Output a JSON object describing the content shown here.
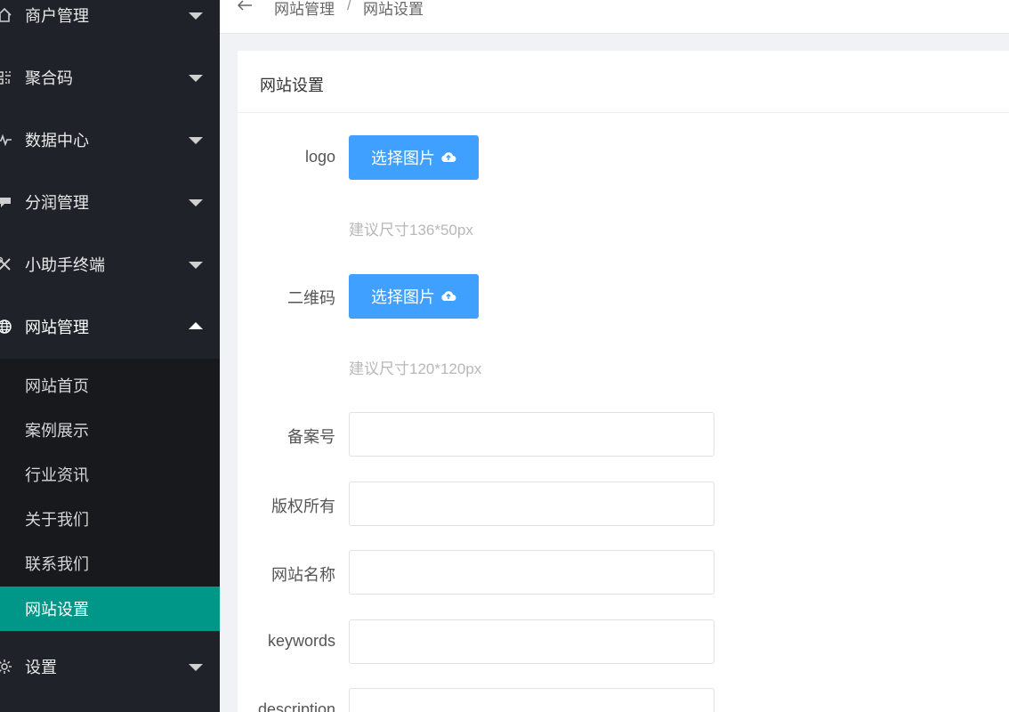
{
  "sidebar": {
    "menu": [
      {
        "label": "商户管理",
        "icon": "home-icon"
      },
      {
        "label": "聚合码",
        "icon": "qrcode-icon"
      },
      {
        "label": "数据中心",
        "icon": "pulse-icon"
      },
      {
        "label": "分润管理",
        "icon": "chat-icon"
      },
      {
        "label": "小助手终端",
        "icon": "tools-icon"
      },
      {
        "label": "网站管理",
        "icon": "globe-icon"
      }
    ],
    "submenu": [
      {
        "label": "网站首页"
      },
      {
        "label": "案例展示"
      },
      {
        "label": "行业资讯"
      },
      {
        "label": "关于我们"
      },
      {
        "label": "联系我们"
      },
      {
        "label": "网站设置"
      }
    ],
    "settings": {
      "label": "设置",
      "icon": "gear-icon"
    },
    "active_color": "#009688"
  },
  "header": {
    "breadcrumb": [
      "网站管理",
      "/",
      "网站设置"
    ]
  },
  "card": {
    "title": "网站设置",
    "logo": {
      "label": "logo",
      "button": "选择图片",
      "hint": "建议尺寸136*50px"
    },
    "qrcode": {
      "label": "二维码",
      "button": "选择图片",
      "hint": "建议尺寸120*120px"
    },
    "fields": [
      {
        "label": "备案号",
        "value": ""
      },
      {
        "label": "版权所有",
        "value": ""
      },
      {
        "label": "网站名称",
        "value": ""
      },
      {
        "label": "keywords",
        "value": ""
      },
      {
        "label": "description",
        "value": ""
      }
    ],
    "button_color": "#3fa0ff"
  }
}
